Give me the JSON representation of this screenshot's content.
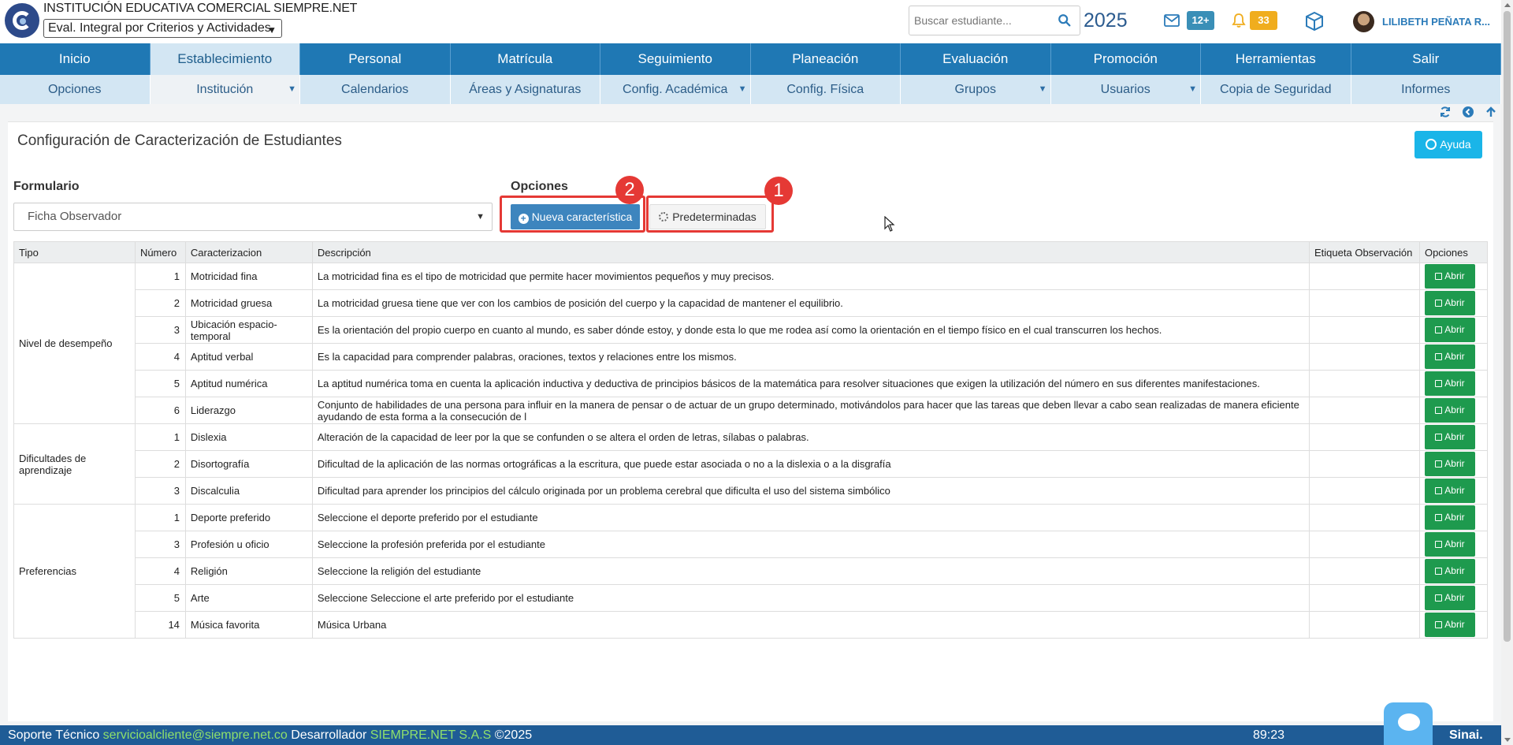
{
  "header": {
    "institution": "INSTITUCIÓN EDUCATIVA COMERCIAL SIEMPRE.NET",
    "mode_selected": "Eval. Integral por Criterios y Actividades",
    "search_placeholder": "Buscar estudiante...",
    "year": "2025",
    "messages_count": "12+",
    "notifications_count": "33",
    "user_name": "LILIBETH PEÑATA R..."
  },
  "main_nav": [
    "Inicio",
    "Establecimiento",
    "Personal",
    "Matrícula",
    "Seguimiento",
    "Planeación",
    "Evaluación",
    "Promoción",
    "Herramientas",
    "Salir"
  ],
  "sub_nav": [
    "Opciones",
    "Institución",
    "Calendarios",
    "Áreas y Asignaturas",
    "Config. Académica",
    "Config. Física",
    "Grupos",
    "Usuarios",
    "Copia de Seguridad",
    "Informes"
  ],
  "page": {
    "title": "Configuración de Caracterización de Estudiantes",
    "help_label": "Ayuda",
    "form_label": "Formulario",
    "form_selected": "Ficha Observador",
    "options_label": "Opciones",
    "new_button": "Nueva característica",
    "default_button": "Predeterminadas",
    "marker_1": "1",
    "marker_2": "2"
  },
  "table": {
    "headers": [
      "Tipo",
      "Número",
      "Caracterizacion",
      "Descripción",
      "Etiqueta Observación",
      "Opciones"
    ],
    "open_label": "Abrir",
    "groups": [
      {
        "tipo": "Nivel de desempeño",
        "rows": [
          {
            "num": "1",
            "name": "Motricidad fina",
            "desc": "La motricidad fina es el tipo de motricidad que permite hacer movimientos pequeños y muy precisos."
          },
          {
            "num": "2",
            "name": "Motricidad gruesa",
            "desc": "La motricidad gruesa tiene que ver con los cambios de posición del cuerpo y la capacidad de mantener el equilibrio."
          },
          {
            "num": "3",
            "name": "Ubicación espacio-temporal",
            "desc": "Es la orientación del propio cuerpo en cuanto al mundo, es saber dónde estoy, y donde esta lo que me rodea así como la orientación en el tiempo físico en el cual transcurren los hechos."
          },
          {
            "num": "4",
            "name": "Aptitud verbal",
            "desc": "Es la capacidad para comprender palabras, oraciones, textos y relaciones entre los mismos."
          },
          {
            "num": "5",
            "name": "Aptitud numérica",
            "desc": "La aptitud numérica toma en cuenta la aplicación inductiva y deductiva de principios básicos de la matemática para resolver situaciones que exigen la utilización del número en sus diferentes manifestaciones."
          },
          {
            "num": "6",
            "name": "Liderazgo",
            "desc": "Conjunto de habilidades de una persona para influir en la manera de pensar o de actuar de un grupo determinado, motivándolos para hacer que las tareas que deben llevar a cabo sean realizadas de manera eficiente ayudando de esta forma a la consecución de l"
          }
        ]
      },
      {
        "tipo": "Dificultades de aprendizaje",
        "rows": [
          {
            "num": "1",
            "name": "Dislexia",
            "desc": "Alteración de la capacidad de leer por la que se confunden o se altera el orden de letras, sílabas o palabras."
          },
          {
            "num": "2",
            "name": "Disortografía",
            "desc": "Dificultad de la aplicación de las normas ortográficas a la escritura, que puede estar asociada o no a la dislexia o a la disgrafía"
          },
          {
            "num": "3",
            "name": "Discalculia",
            "desc": "Dificultad para aprender los principios del cálculo originada por un problema cerebral que dificulta el uso del sistema simbólico"
          }
        ]
      },
      {
        "tipo": "Preferencias",
        "rows": [
          {
            "num": "1",
            "name": "Deporte preferido",
            "desc": "Seleccione el deporte preferido por el estudiante"
          },
          {
            "num": "3",
            "name": "Profesión u oficio",
            "desc": "Seleccione la profesión preferida por el estudiante"
          },
          {
            "num": "4",
            "name": "Religión",
            "desc": "Seleccione la religión del estudiante"
          },
          {
            "num": "5",
            "name": "Arte",
            "desc": "Seleccione Seleccione el arte preferido por el estudiante"
          },
          {
            "num": "14",
            "name": "Música favorita",
            "desc": "Música Urbana"
          }
        ]
      }
    ]
  },
  "footer": {
    "support_label": "Soporte Técnico",
    "support_email": "servicioalcliente@siempre.net.co",
    "developer_label": "Desarrollador",
    "developer_name": "SIEMPRE.NET S.A.S",
    "copyright": "©2025",
    "timer": "89:23",
    "brand": "Sinai."
  },
  "colors": {
    "nav_blue": "#1f78b4",
    "subnav_blue": "#d3e6f3",
    "open_green": "#1e9a4e",
    "highlight_red": "#e53935",
    "help_cyan": "#1ab5e8"
  }
}
